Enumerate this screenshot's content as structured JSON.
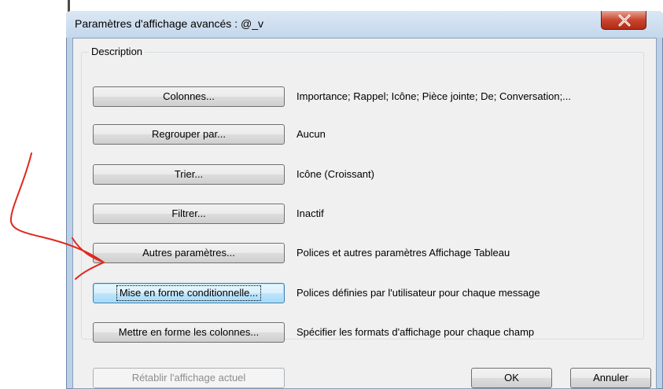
{
  "dialog": {
    "title": "Paramètres d'affichage avancés : @_v",
    "close_glyph": "x"
  },
  "group": {
    "label": "Description"
  },
  "rows": [
    {
      "button": "Colonnes...",
      "description": "Importance; Rappel; Icône; Pièce jointe; De; Conversation;..."
    },
    {
      "button": "Regrouper par...",
      "description": "Aucun"
    },
    {
      "button": "Trier...",
      "description": "Icône (Croissant)"
    },
    {
      "button": "Filtrer...",
      "description": "Inactif"
    },
    {
      "button": "Autres paramètres...",
      "description": "Polices et autres paramètres Affichage Tableau"
    },
    {
      "button": "Mise en forme conditionnelle...",
      "description": "Polices définies par l'utilisateur pour chaque message"
    },
    {
      "button": "Mettre en forme les colonnes...",
      "description": "Spécifier les formats d'affichage pour chaque champ"
    }
  ],
  "footer": {
    "reset_label": "Rétablir l'affichage actuel",
    "ok_label": "OK",
    "cancel_label": "Annuler"
  },
  "colors": {
    "annotation_arrow": "#e0281e",
    "close_button": "#c9452e",
    "focus_button_border": "#3c7fb1"
  }
}
